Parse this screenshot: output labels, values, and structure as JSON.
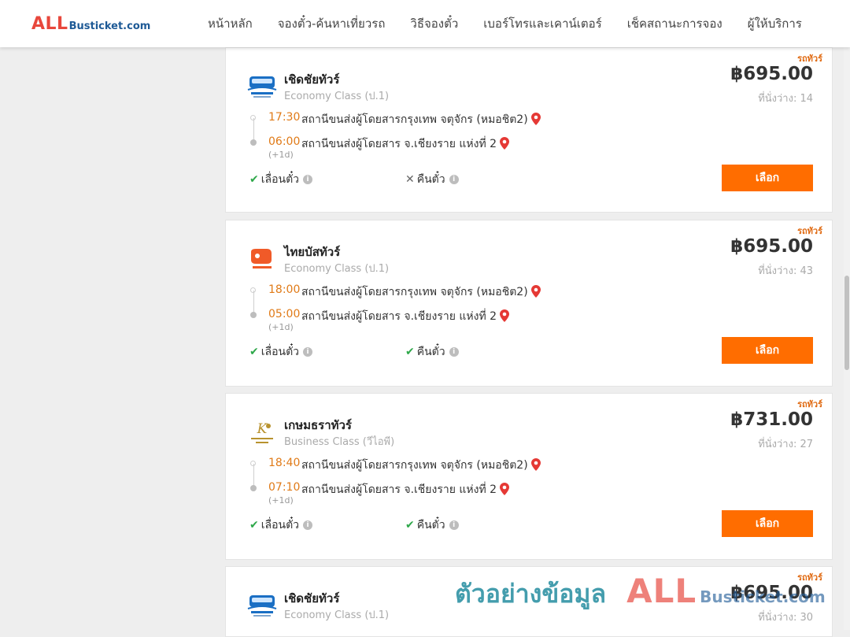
{
  "header": {
    "logo_all": "ALL",
    "logo_rest": "Busticket.com",
    "nav": [
      "หน้าหลัก",
      "จองตั๋ว-ค้นหาเที่ยวรถ",
      "วิธีจองตั๋ว",
      "เบอร์โทรและเคาน์เตอร์",
      "เช็คสถานะการจอง",
      "ผู้ให้บริการ"
    ]
  },
  "cards": [
    {
      "badge": "รถทัวร์",
      "operator": "เชิดชัยทัวร์",
      "logo": "bus-logo-icon",
      "class": "Economy Class (ป.1)",
      "price": "฿695.00",
      "seats": "ที่นั่งว่าง: 14",
      "depart_time": "17:30",
      "depart_station": "สถานีขนส่งผู้โดยสารกรุงเทพ จตุจักร (หมอชิต2)",
      "arrive_time": "06:00",
      "arrive_station": "สถานีขนส่งผู้โดยสาร จ.เชียงราย แห่งที่ 2",
      "next_day": "(+1d)",
      "feature1": "เลื่อนตั๋ว",
      "feature1_ok": true,
      "feature2": "คืนตั๋ว",
      "feature2_ok": false,
      "button": "เลือก"
    },
    {
      "badge": "รถทัวร์",
      "operator": "ไทยบัสทัวร์",
      "logo": "thai-bus-logo-icon",
      "class": "Economy Class (ป.1)",
      "price": "฿695.00",
      "seats": "ที่นั่งว่าง: 43",
      "depart_time": "18:00",
      "depart_station": "สถานีขนส่งผู้โดยสารกรุงเทพ จตุจักร (หมอชิต2)",
      "arrive_time": "05:00",
      "arrive_station": "สถานีขนส่งผู้โดยสาร จ.เชียงราย แห่งที่ 2",
      "next_day": "(+1d)",
      "feature1": "เลื่อนตั๋ว",
      "feature1_ok": true,
      "feature2": "คืนตั๋ว",
      "feature2_ok": true,
      "button": "เลือก"
    },
    {
      "badge": "รถทัวร์",
      "operator": "เกษมธราทัวร์",
      "logo": "kasemthara-logo-icon",
      "class": "Business Class (วีไอพี)",
      "price": "฿731.00",
      "seats": "ที่นั่งว่าง: 27",
      "depart_time": "18:40",
      "depart_station": "สถานีขนส่งผู้โดยสารกรุงเทพ จตุจักร (หมอชิต2)",
      "arrive_time": "07:10",
      "arrive_station": "สถานีขนส่งผู้โดยสาร จ.เชียงราย แห่งที่ 2",
      "next_day": "(+1d)",
      "feature1": "เลื่อนตั๋ว",
      "feature1_ok": true,
      "feature2": "คืนตั๋ว",
      "feature2_ok": true,
      "button": "เลือก"
    },
    {
      "badge": "รถทัวร์",
      "operator": "เชิดชัยทัวร์",
      "logo": "bus-logo-icon",
      "class": "Economy Class (ป.1)",
      "price": "฿695.00",
      "seats": "ที่นั่งว่าง: 30",
      "depart_time": "",
      "depart_station": "",
      "arrive_time": "",
      "arrive_station": "",
      "next_day": "",
      "feature1": "",
      "feature1_ok": true,
      "feature2": "",
      "feature2_ok": true,
      "button": ""
    }
  ],
  "watermark": {
    "text": "ตัวอย่างข้อมูล",
    "all": "ALL",
    "rest": "Busticket.com"
  },
  "colors": {
    "accent": "#ff6d00",
    "time": "#e07a17",
    "check": "#2ea84a",
    "pin": "#e53935"
  }
}
